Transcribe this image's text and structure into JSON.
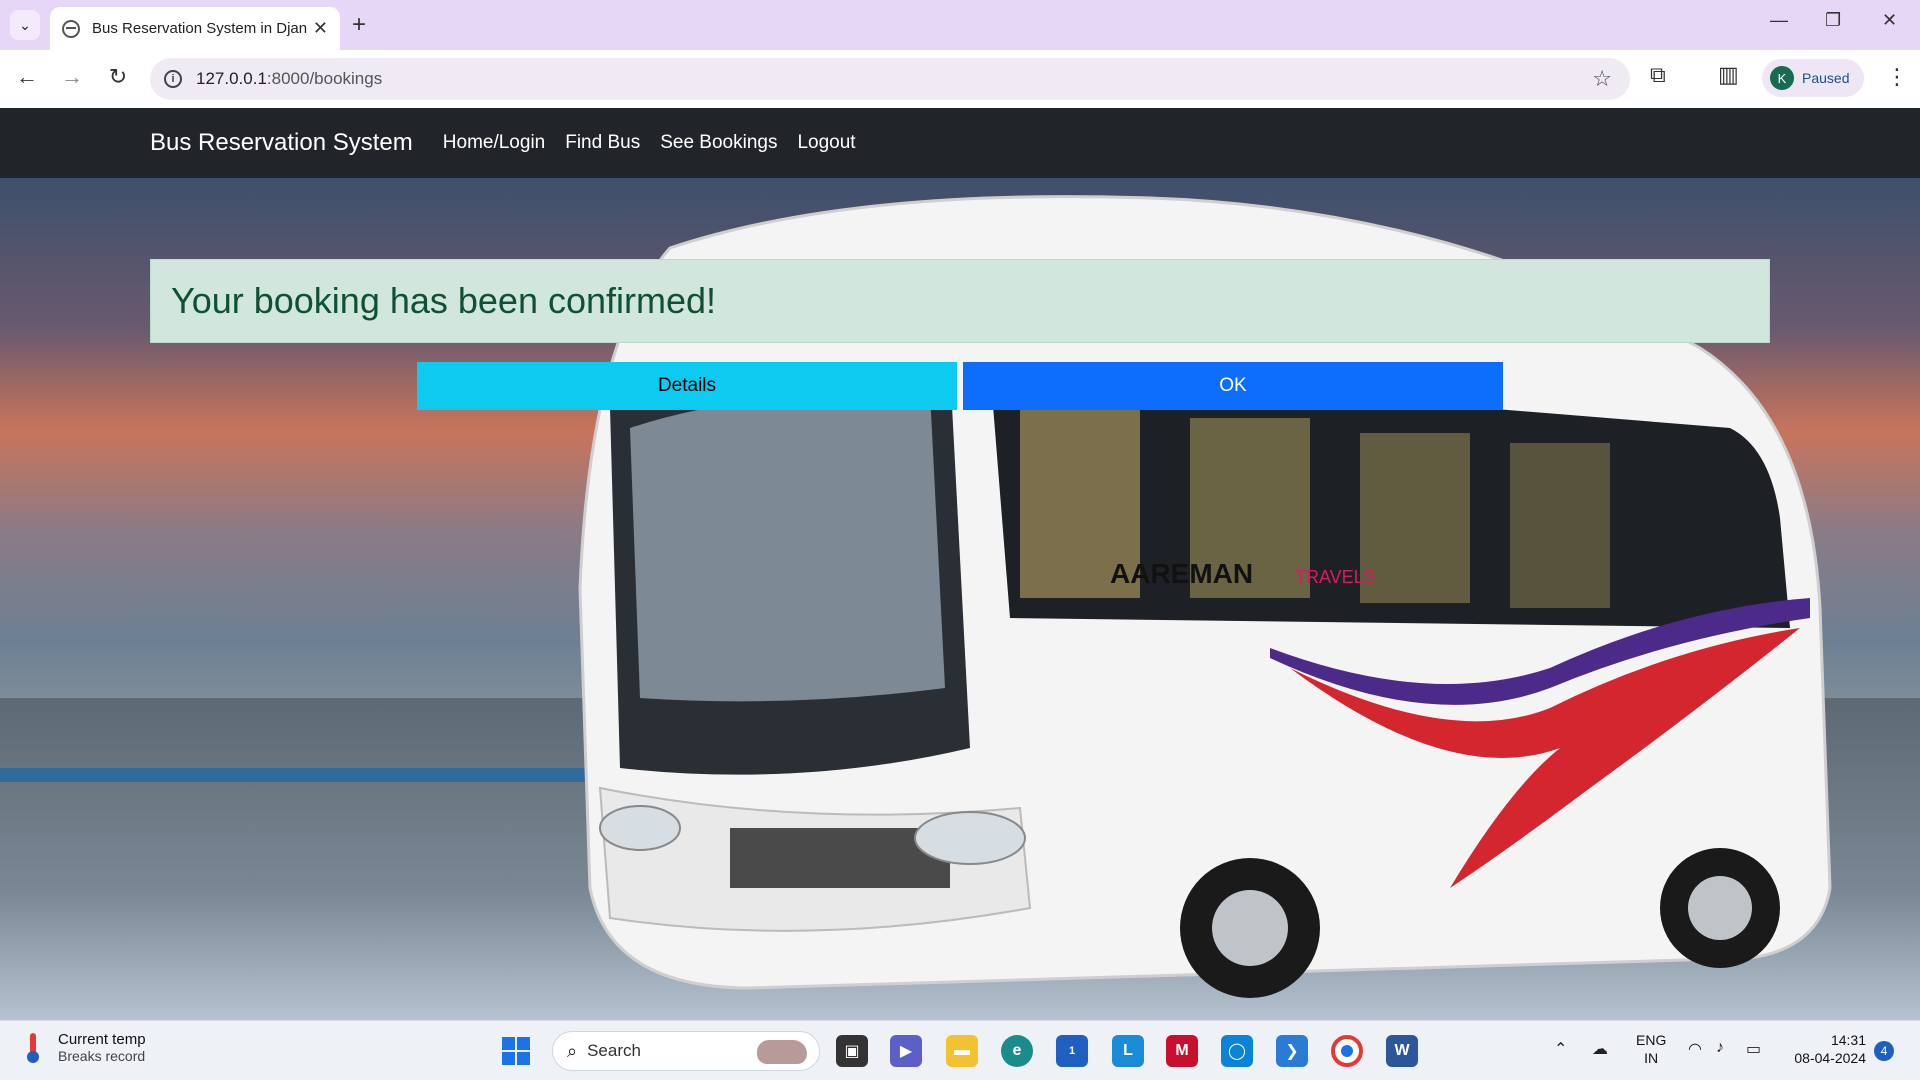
{
  "browser": {
    "tab_title": "Bus Reservation System in Djan",
    "url_host": "127.0.0.1",
    "url_path": ":8000/bookings",
    "profile_initial": "K",
    "profile_status": "Paused"
  },
  "navbar": {
    "brand": "Bus Reservation System",
    "links": [
      "Home/Login",
      "Find Bus",
      "See Bookings",
      "Logout"
    ]
  },
  "alert": {
    "message": "Your booking has been confirmed!"
  },
  "buttons": {
    "details": "Details",
    "ok": "OK"
  },
  "bus_livery": {
    "brand": "AAREMAN",
    "suffix": "TRAVELS"
  },
  "taskbar": {
    "weather_title": "Current temp",
    "weather_sub": "Breaks record",
    "search_label": "Search",
    "store_badge": "1",
    "lang_top": "ENG",
    "lang_bottom": "IN",
    "time": "14:31",
    "date": "08-04-2024",
    "notification_count": "4"
  },
  "colors": {
    "navbar_bg": "#212529",
    "alert_bg": "#d1e7dd",
    "alert_text": "#0f5132",
    "details_btn": "#0dcaf0",
    "ok_btn": "#0d6efd"
  }
}
